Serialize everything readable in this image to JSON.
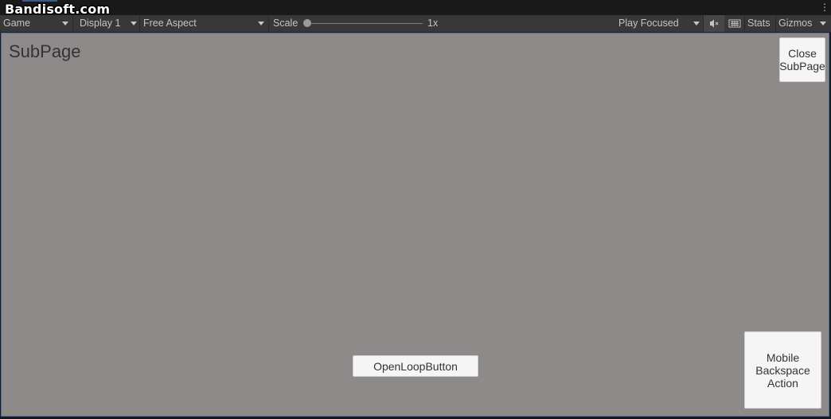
{
  "watermark": "Bandisoft.com",
  "toolbar": {
    "view_label": "Game",
    "display_label": "Display 1",
    "aspect_label": "Free Aspect",
    "scale_label": "Scale",
    "scale_value": "1x",
    "scale_level": 0,
    "play_mode_label": "Play Focused",
    "stats_label": "Stats",
    "gizmos_label": "Gizmos",
    "icons": {
      "mute": "mute-audio-icon",
      "keyboard": "keyboard-icon",
      "menu": "kebab-menu-icon"
    }
  },
  "game": {
    "title": "SubPage",
    "close_button_label": "Close\nSubPage",
    "open_loop_button_label": "OpenLoopButton",
    "backspace_button_label": "Mobile\nBackspace\nAction",
    "background_color": "#8f8a8a"
  }
}
